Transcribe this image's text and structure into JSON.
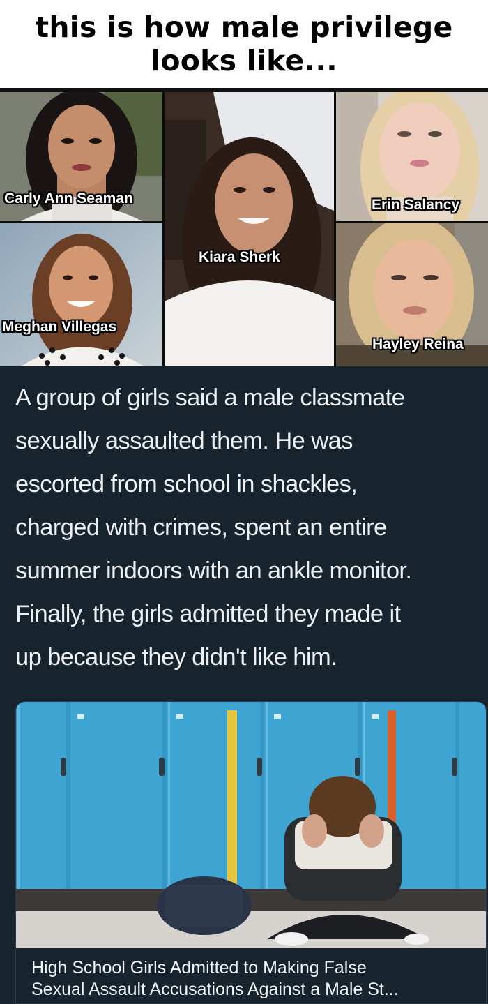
{
  "caption": {
    "line1": "this is how male privilege",
    "line2": "looks like..."
  },
  "photos": [
    {
      "name": "Carly Ann Seaman"
    },
    {
      "name": "Kiara Sherk"
    },
    {
      "name": "Erin Salancy"
    },
    {
      "name": "Meghan Villegas"
    },
    {
      "name": "Hayley Reina"
    }
  ],
  "tweet": {
    "lines": [
      "A group of girls said a male classmate",
      "sexually assaulted them. He was",
      "escorted from school in shackles,",
      "charged with crimes, spent an entire",
      "summer indoors with an ankle monitor.",
      "Finally, the girls admitted they made it",
      "up because they didn't like him."
    ]
  },
  "article": {
    "title_line1": "High School Girls Admitted to Making False",
    "title_line2": "Sexual Assault Accusations Against a Male St..."
  },
  "colors": {
    "background": "#17232d",
    "text": "#eef1f4",
    "lockers": "#3aa3d0"
  }
}
